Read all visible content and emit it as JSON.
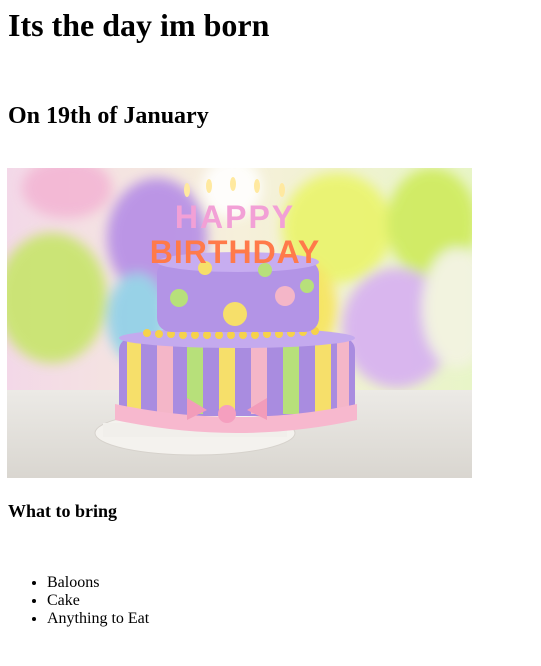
{
  "page": {
    "title": "Its the day im born",
    "date_heading": "On 19th of January",
    "image": {
      "alt": "birthday-cake-photo",
      "cake_text": "HAPPY BIRTHDAY"
    },
    "bring_heading": "What to bring",
    "bring_items": [
      "Baloons",
      "Cake",
      "Anything to Eat"
    ]
  }
}
